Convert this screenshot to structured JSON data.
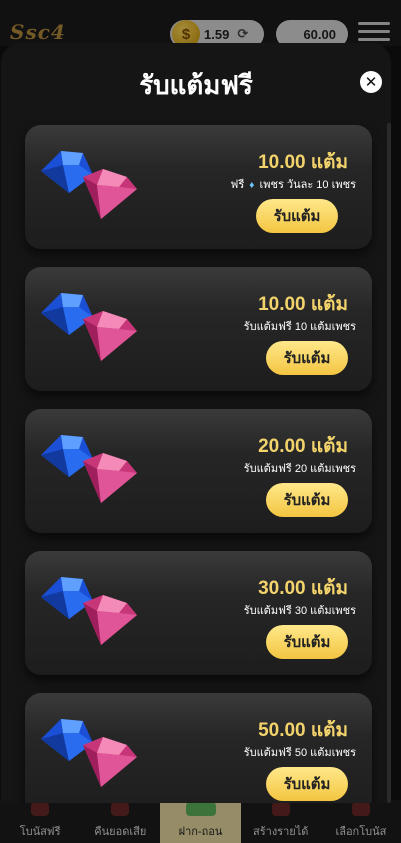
{
  "header": {
    "logo_text": "Ssc4",
    "coin_balance": "1.59",
    "gem_balance": "60.00"
  },
  "modal": {
    "title": "รับแต้มฟรี",
    "close_symbol": "✕"
  },
  "rewards": [
    {
      "amount": "10.00 แต้ม",
      "desc_prefix": "ฟรี",
      "desc_suffix": "เพชร วันละ 10 เพชร",
      "button_label": "รับแต้ม"
    },
    {
      "amount": "10.00 แต้ม",
      "desc": "รับแต้มฟรี 10 แต้มเพชร",
      "button_label": "รับแต้ม"
    },
    {
      "amount": "20.00 แต้ม",
      "desc": "รับแต้มฟรี 20 แต้มเพชร",
      "button_label": "รับแต้ม"
    },
    {
      "amount": "30.00 แต้ม",
      "desc": "รับแต้มฟรี 30 แต้มเพชร",
      "button_label": "รับแต้ม"
    },
    {
      "amount": "50.00 แต้ม",
      "desc": "รับแต้มฟรี 50 แต้มเพชร",
      "button_label": "รับแต้ม"
    }
  ],
  "bottom_nav": [
    {
      "label": "โบนัสฟรี"
    },
    {
      "label": "คืนยอดเสีย"
    },
    {
      "label": "ฝาก-ถอน"
    },
    {
      "label": "สร้างรายได้"
    },
    {
      "label": "เลือกโบนัส"
    }
  ],
  "colors": {
    "accent_gold": "#f3d36b",
    "button_gold": "#f3c541",
    "card_dark": "#1d1d1d"
  },
  "icons": {
    "gem_blue": "blue-diamond-icon",
    "gem_pink": "pink-diamond-icon"
  }
}
